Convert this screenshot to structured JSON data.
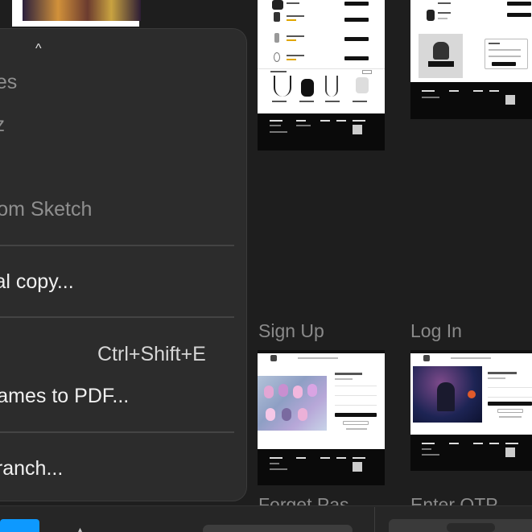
{
  "canvas": {
    "frames": [
      {
        "label": "Sign Up"
      },
      {
        "label": "Log In"
      },
      {
        "label": "Forget Pas"
      },
      {
        "label": "Enter OTP"
      }
    ]
  },
  "menu": {
    "caret": "^",
    "items": [
      {
        "label": "des",
        "style": "dim"
      },
      {
        "label": "zz",
        "style": "dim"
      },
      {
        "label": "e",
        "style": "dim"
      },
      {
        "label": "from Sketch",
        "style": "dim"
      },
      {
        "label": "cal copy...",
        "style": "bright"
      },
      {
        "label": ".",
        "style": "bright",
        "shortcut": "Ctrl+Shift+E"
      },
      {
        "label": "frames to PDF...",
        "style": "bright"
      },
      {
        "label": "branch...",
        "style": "bright"
      }
    ]
  },
  "colors": {
    "canvas_bg": "#1e1e1e",
    "menu_bg": "#2c2c2c",
    "accent": "#0d99ff"
  }
}
